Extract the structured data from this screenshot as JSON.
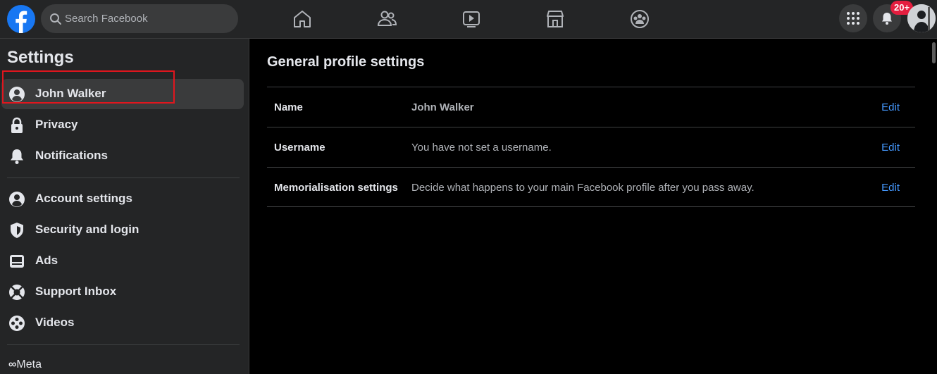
{
  "topbar": {
    "search_placeholder": "Search Facebook",
    "notification_badge": "20+",
    "nav": [
      "home-icon",
      "friends-icon",
      "watch-icon",
      "marketplace-icon",
      "groups-icon"
    ]
  },
  "sidebar": {
    "title": "Settings",
    "items": [
      {
        "label": "John Walker",
        "icon": "profile-icon"
      },
      {
        "label": "Privacy",
        "icon": "lock-icon"
      },
      {
        "label": "Notifications",
        "icon": "bell-icon"
      },
      {
        "label": "Account settings",
        "icon": "account-icon"
      },
      {
        "label": "Security and login",
        "icon": "shield-icon"
      },
      {
        "label": "Ads",
        "icon": "ads-icon"
      },
      {
        "label": "Support Inbox",
        "icon": "lifebuoy-icon"
      },
      {
        "label": "Videos",
        "icon": "film-icon"
      }
    ],
    "footer": "Meta"
  },
  "main": {
    "title": "General profile settings",
    "rows": [
      {
        "key": "Name",
        "value": "John Walker",
        "action": "Edit"
      },
      {
        "key": "Username",
        "value": "You have not set a username.",
        "action": "Edit"
      },
      {
        "key": "Memorialisation settings",
        "value": "Decide what happens to your main Facebook profile after you pass away.",
        "action": "Edit"
      }
    ]
  },
  "colors": {
    "accent": "#1877f2",
    "link": "#4599ff",
    "badge": "#e41e3f",
    "highlight": "#e0161e"
  }
}
